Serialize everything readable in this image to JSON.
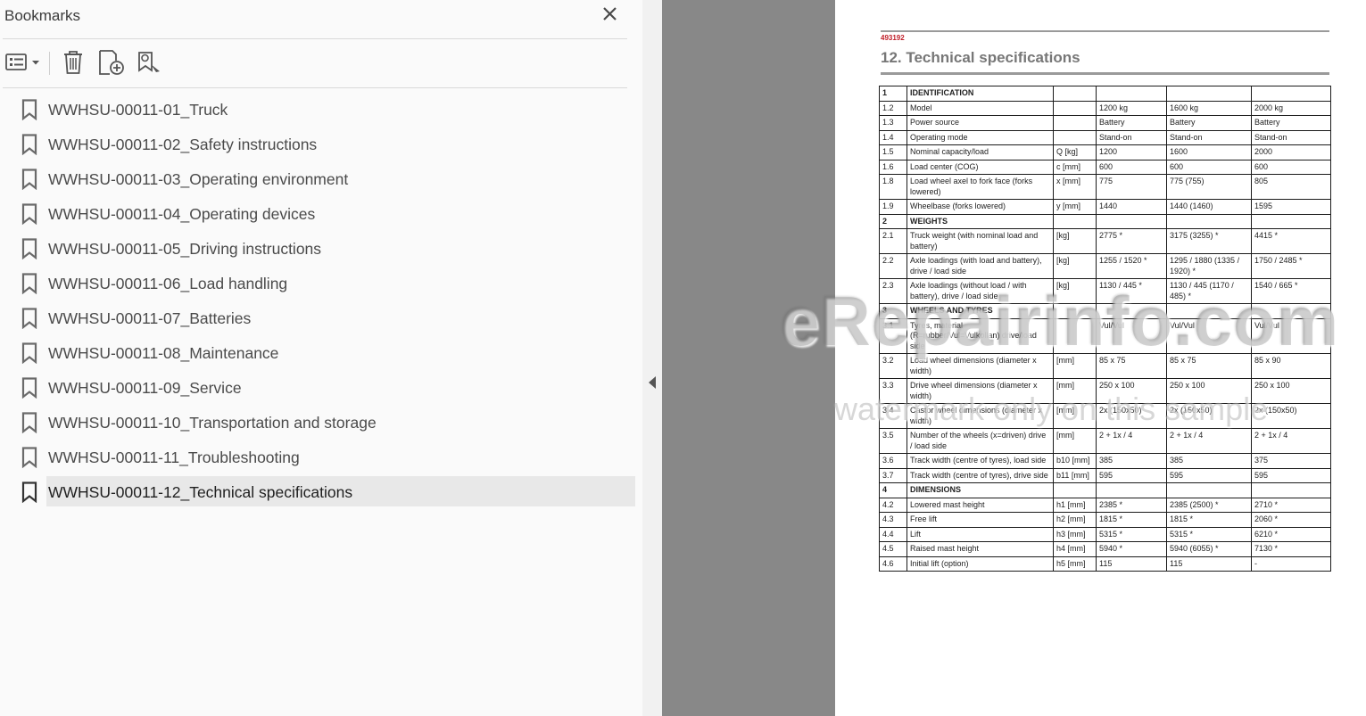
{
  "panel": {
    "title": "Bookmarks",
    "bookmarks": [
      {
        "label": "WWHSU-00011-01_Truck"
      },
      {
        "label": "WWHSU-00011-02_Safety instructions"
      },
      {
        "label": "WWHSU-00011-03_Operating environment"
      },
      {
        "label": "WWHSU-00011-04_Operating devices"
      },
      {
        "label": "WWHSU-00011-05_Driving instructions"
      },
      {
        "label": "WWHSU-00011-06_Load handling"
      },
      {
        "label": "WWHSU-00011-07_Batteries"
      },
      {
        "label": "WWHSU-00011-08_Maintenance"
      },
      {
        "label": "WWHSU-00011-09_Service"
      },
      {
        "label": "WWHSU-00011-10_Transportation and storage"
      },
      {
        "label": "WWHSU-00011-11_Troubleshooting"
      },
      {
        "label": "WWHSU-00011-12_Technical specifications",
        "selected": true
      }
    ],
    "toolbar_icons": [
      "options-menu-icon",
      "delete-bookmark-icon",
      "new-bookmark-icon",
      "find-bookmark-icon"
    ]
  },
  "document": {
    "code": "493192",
    "title": "12. Technical specifications",
    "rows": [
      {
        "section": true,
        "cells": [
          "1",
          "IDENTIFICATION",
          "",
          "",
          "",
          ""
        ]
      },
      {
        "cells": [
          "1.2",
          "Model",
          "",
          "1200 kg",
          "1600 kg",
          "2000 kg"
        ]
      },
      {
        "cells": [
          "1.3",
          "Power source",
          "",
          "Battery",
          "Battery",
          "Battery"
        ]
      },
      {
        "cells": [
          "1.4",
          "Operating mode",
          "",
          "Stand-on",
          "Stand-on",
          "Stand-on"
        ]
      },
      {
        "cells": [
          "1.5",
          "Nominal capacity/load",
          "Q [kg]",
          "1200",
          "1600",
          "2000"
        ]
      },
      {
        "cells": [
          "1.6",
          "Load center (COG)",
          "c [mm]",
          "600",
          "600",
          "600"
        ]
      },
      {
        "cells": [
          "1.8",
          "Load wheel axel to fork face (forks lowered)",
          "x [mm]",
          "775",
          "775 (755)",
          "805"
        ]
      },
      {
        "cells": [
          "1.9",
          "Wheelbase (forks lowered)",
          "y [mm]",
          "1440",
          "1440 (1460)",
          "1595"
        ]
      },
      {
        "section": true,
        "cells": [
          "2",
          "WEIGHTS",
          "",
          "",
          "",
          ""
        ]
      },
      {
        "cells": [
          "2.1",
          "Truck weight (with nominal load and battery)",
          "[kg]",
          "2775 *",
          "3175 (3255) *",
          "4415 *"
        ]
      },
      {
        "cells": [
          "2.2",
          "Axle loadings (with load and battery), drive / load side",
          "[kg]",
          "1255 / 1520 *",
          "1295 / 1880 (1335 / 1920) *",
          "1750 / 2485 *"
        ]
      },
      {
        "cells": [
          "2.3",
          "Axle loadings (without load / with battery), drive / load side",
          "[kg]",
          "1130 / 445 *",
          "1130 / 445 (1170 / 485) *",
          "1540 / 665 *"
        ]
      },
      {
        "section": true,
        "cells": [
          "3",
          "WHEELS AND TYRES",
          "",
          "",
          "",
          ""
        ]
      },
      {
        "cells": [
          "3.1",
          "Tyres, material (R=rubber/Vul=Vulkollan) drive/load side",
          "",
          "Vul/Vul",
          "Vul/Vul",
          "Vul/Vul"
        ]
      },
      {
        "cells": [
          "3.2",
          "Load wheel dimensions (diameter x width)",
          "[mm]",
          "85 x 75",
          "85 x 75",
          "85 x 90"
        ]
      },
      {
        "cells": [
          "3.3",
          "Drive wheel dimensions (diameter x width)",
          "[mm]",
          "250 x 100",
          "250 x 100",
          "250 x 100"
        ]
      },
      {
        "cells": [
          "3.4",
          "Castor wheel dimensions (diameter x width)",
          "[mm]",
          "2x (150x50)",
          "2x (150x50)",
          "2x (150x50)"
        ]
      },
      {
        "cells": [
          "3.5",
          "Number of the wheels (x=driven) drive / load side",
          "[mm]",
          "2 + 1x / 4",
          "2 + 1x / 4",
          "2 + 1x / 4"
        ]
      },
      {
        "cells": [
          "3.6",
          "Track width (centre of tyres), load side",
          "b10 [mm]",
          "385",
          "385",
          "375"
        ]
      },
      {
        "cells": [
          "3.7",
          "Track width (centre of tyres), drive side",
          "b11 [mm]",
          "595",
          "595",
          "595"
        ]
      },
      {
        "section": true,
        "cells": [
          "4",
          "DIMENSIONS",
          "",
          "",
          "",
          ""
        ]
      },
      {
        "cells": [
          "4.2",
          "Lowered mast height",
          "h1 [mm]",
          "2385 *",
          "2385 (2500) *",
          "2710 *"
        ]
      },
      {
        "cells": [
          "4.3",
          "Free lift",
          "h2 [mm]",
          "1815 *",
          "1815 *",
          "2060 *"
        ]
      },
      {
        "cells": [
          "4.4",
          "Lift",
          "h3 [mm]",
          "5315 *",
          "5315 *",
          "6210 *"
        ]
      },
      {
        "cells": [
          "4.5",
          "Raised mast height",
          "h4 [mm]",
          "5940 *",
          "5940 (6055) *",
          "7130 *"
        ]
      },
      {
        "cells": [
          "4.6",
          "Initial lift (option)",
          "h5 [mm]",
          "115",
          "115",
          "-"
        ]
      }
    ]
  },
  "watermark": {
    "line1": "eRepairinfo.com",
    "line2": "watermark only on this sample"
  },
  "colors": {
    "doc_code": "#c0202a",
    "selected_bg": "#e8e8e8",
    "viewport_bg": "#888888"
  }
}
